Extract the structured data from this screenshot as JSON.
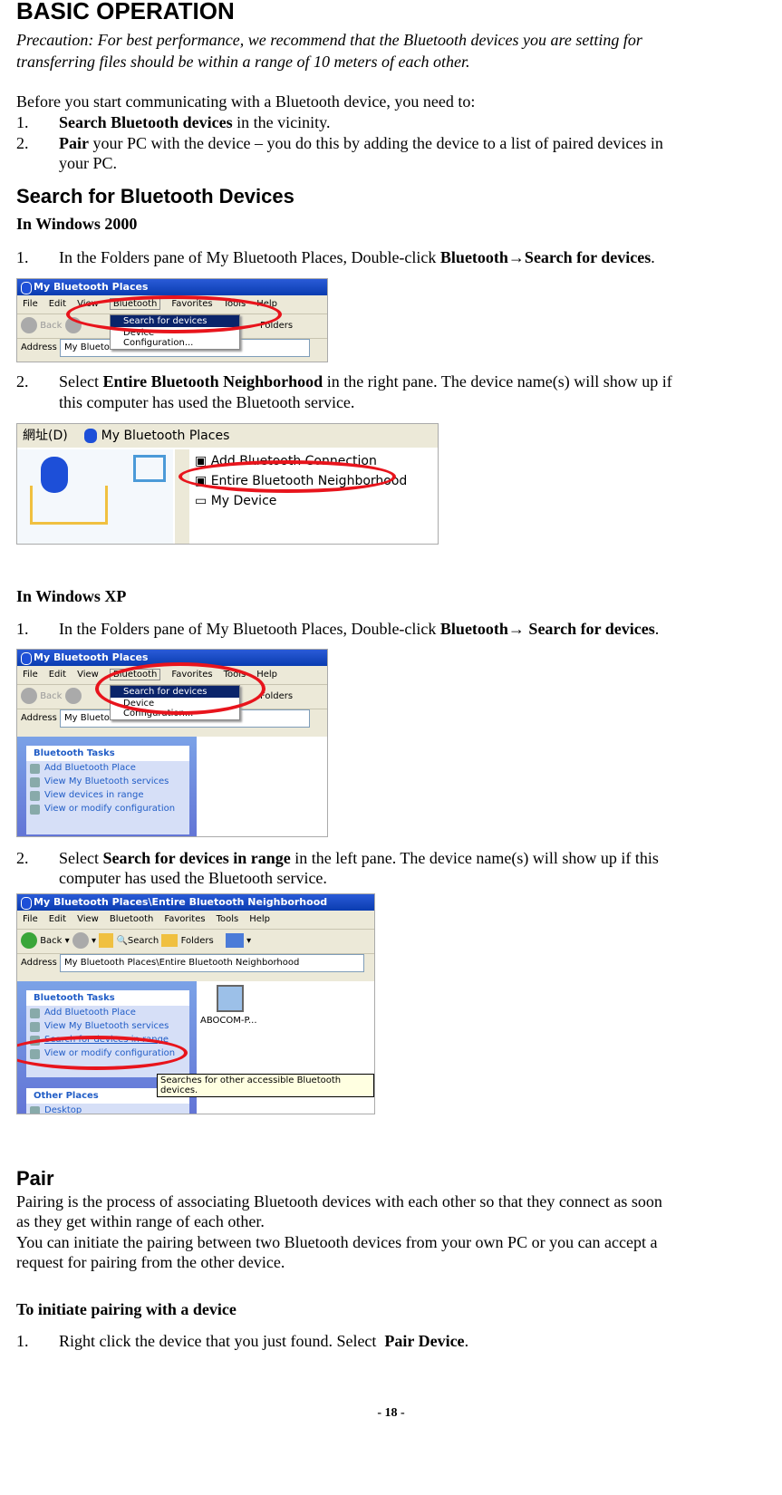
{
  "title": "BASIC OPERATION",
  "precaution": [
    "Precaution: For best performance, we recommend that the Bluetooth devices you are setting for",
    "transferring files should be within a range of 10 meters of each other."
  ],
  "intro": "Before you start communicating with a Bluetooth device, you need to:",
  "needs": [
    {
      "num": "1.",
      "bold": "Search Bluetooth devices",
      "rest": " in the vicinity."
    },
    {
      "num": "2.",
      "bold": "Pair",
      "rest": " your PC with the device – you do this by adding the device to a list of paired devices in",
      "cont": "your PC."
    }
  ],
  "search_heading": "Search for Bluetooth Devices",
  "win2000": {
    "heading": "In Windows 2000",
    "step1": {
      "num": "1.",
      "text": "In the Folders pane of My Bluetooth Places, Double-click ",
      "bold": "Bluetooth→Search for devices",
      "end": "."
    },
    "shot1": {
      "title": "My Bluetooth Places",
      "menu": [
        "File",
        "Edit",
        "View",
        "Bluetooth",
        "Favorites",
        "Tools",
        "Help"
      ],
      "back": "Back",
      "folders": "Folders",
      "address_label": "Address",
      "address": "My Bluetooth Places",
      "dropdown": [
        "Search for devices",
        "Device Configuration..."
      ]
    },
    "step2": {
      "num": "2.",
      "text": "Select ",
      "bold": "Entire Bluetooth Neighborhood",
      "rest": " in the right pane. The device name(s) will show up if",
      "cont": "this computer has used the Bluetooth service."
    },
    "shot2": {
      "address_label": "網址(D)",
      "address": "My Bluetooth Places",
      "items": [
        "Add Bluetooth Connection",
        "Entire Bluetooth Neighborhood",
        "My Device"
      ]
    }
  },
  "winxp": {
    "heading": "In Windows XP",
    "step1": {
      "num": "1.",
      "text": "In the Folders pane of My Bluetooth Places, Double-click ",
      "bold": "Bluetooth→ Search for devices",
      "end": "."
    },
    "shot3": {
      "title": "My Bluetooth Places",
      "menu": [
        "File",
        "Edit",
        "View",
        "Bluetooth",
        "Favorites",
        "Tools",
        "Help"
      ],
      "back": "Back",
      "folders": "Folders",
      "address_label": "Address",
      "address": "My Bluetooth Places",
      "dropdown": [
        "Search for devices",
        "Device Configuration..."
      ],
      "tasks_title": "Bluetooth Tasks",
      "tasks": [
        "Add Bluetooth Place",
        "View My Bluetooth services",
        "View devices in range",
        "View or modify configuration"
      ]
    },
    "step2": {
      "num": "2.",
      "text": "Select ",
      "bold": "Search for devices in range",
      "rest": " in the left pane. The device name(s) will show up if this",
      "cont": "computer has used the Bluetooth service."
    },
    "shot4": {
      "title": "My Bluetooth Places\\Entire Bluetooth Neighborhood",
      "menu": [
        "File",
        "Edit",
        "View",
        "Bluetooth",
        "Favorites",
        "Tools",
        "Help"
      ],
      "back": "Back",
      "search": "Search",
      "folders": "Folders",
      "address_label": "Address",
      "address": "My Bluetooth Places\\Entire Bluetooth Neighborhood",
      "tasks_title": "Bluetooth Tasks",
      "tasks": [
        "Add Bluetooth Place",
        "View My Bluetooth services",
        "Search for devices in range",
        "View or modify configuration"
      ],
      "device": "ABOCOM-P...",
      "tooltip": "Searches for other accessible Bluetooth devices.",
      "other_title": "Other Places",
      "other": [
        "Desktop"
      ]
    }
  },
  "pair": {
    "heading": "Pair",
    "lines": [
      "Pairing is the process of associating Bluetooth devices with each other so that they connect as soon",
      "as they get within range of each other.",
      "You can initiate the pairing between two Bluetooth devices from your own PC or you can accept a",
      "request for pairing from the other device."
    ],
    "subheading": "To initiate pairing with a device",
    "step1": {
      "num": "1.",
      "text": "Right click the device that you just found. Select  ",
      "bold": "Pair Device",
      "end": "."
    }
  },
  "footer": "- 18 -",
  "colors": {
    "highlight_ellipse": "#e8141c",
    "xp_titlebar": "#0a3cb0",
    "link": "#215dc6"
  }
}
